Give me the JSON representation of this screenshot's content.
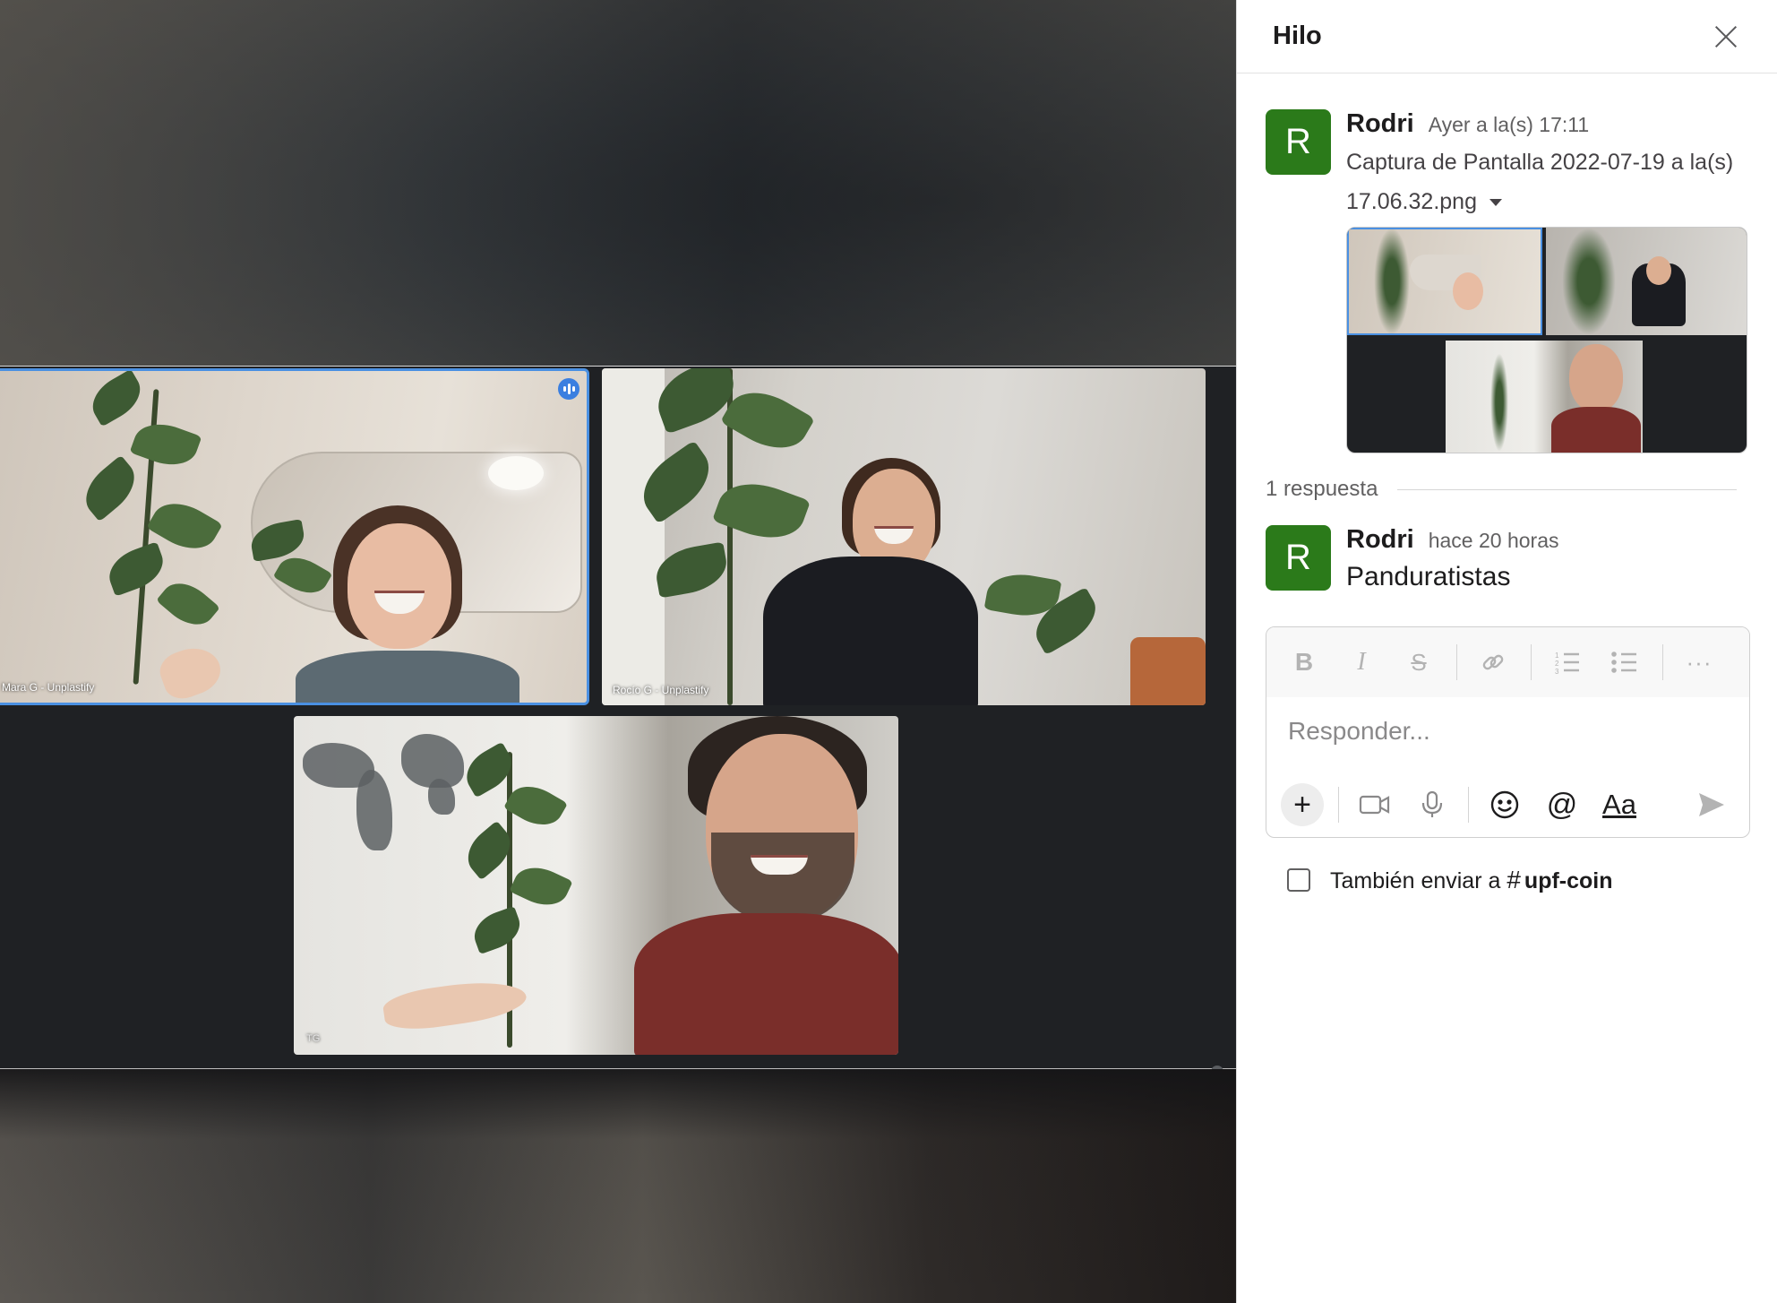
{
  "viewer": {
    "participants": [
      {
        "name_tag": "Mara G - Unplastify"
      },
      {
        "name_tag": "Rocío G - Unplastify"
      },
      {
        "name_tag": "TG"
      }
    ]
  },
  "thread": {
    "title": "Hilo",
    "parent": {
      "avatar_letter": "R",
      "author": "Rodri",
      "time": "Ayer a la(s) 17:11",
      "file_name": "Captura de Pantalla 2022-07-19 a la(s) 17.06.32.png"
    },
    "reply_count": "1 respuesta",
    "reply": {
      "avatar_letter": "R",
      "author": "Rodri",
      "time": "hace 20 horas",
      "text": "Panduratistas"
    },
    "composer": {
      "placeholder": "Responder...",
      "format_tools": [
        "bold-icon",
        "italic-icon",
        "strikethrough-icon",
        "link-icon",
        "ordered-list-icon",
        "bulleted-list-icon",
        "more-icon"
      ],
      "aa_label": "Aa"
    },
    "also_send": {
      "label": "También enviar a",
      "channel": "upf-coin"
    }
  },
  "colors": {
    "avatar": "#2b7a1a",
    "active_speaker": "#3b7fe0"
  }
}
